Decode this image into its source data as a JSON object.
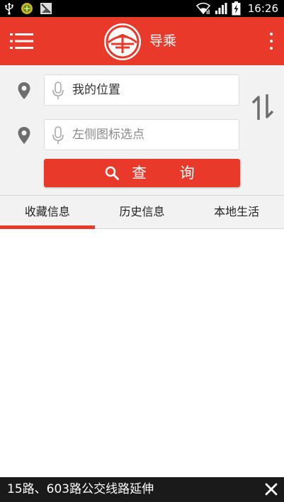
{
  "status_bar": {
    "time": "16:26",
    "icons": [
      "usb-icon",
      "app-notification-icon",
      "image-notification-icon",
      "wifi-icon",
      "signal-icon",
      "battery-icon"
    ]
  },
  "app_bar": {
    "title": "导乘",
    "menu_icon": "hamburger-menu-icon",
    "logo": "bus-company-logo",
    "more_icon": "more-vert-icon"
  },
  "search": {
    "from_value": "我的位置",
    "to_placeholder": "左侧图标选点",
    "query_label": "查 询",
    "pin_icon": "location-pin-icon",
    "mic_icon": "microphone-icon",
    "swap_icon": "swap-vertical-icon",
    "query_icon": "magnifier-icon"
  },
  "tabs": [
    {
      "label": "收藏信息",
      "active": true
    },
    {
      "label": "历史信息",
      "active": false
    },
    {
      "label": "本地生活",
      "active": false
    }
  ],
  "notice": {
    "text": "15路、603路公交线路延伸",
    "close_icon": "close-icon"
  },
  "colors": {
    "primary": "#e8392b",
    "panel_bg": "#f2f2f2",
    "notice_bg": "#1a1a1a"
  }
}
